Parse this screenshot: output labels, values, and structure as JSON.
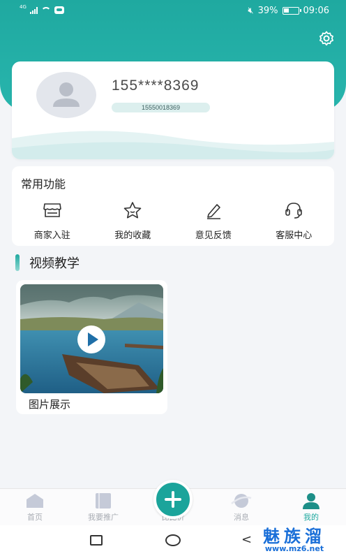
{
  "status_bar": {
    "network": "4G",
    "battery_percent": "39%",
    "battery_level": 0.39,
    "time": "09:06"
  },
  "profile": {
    "masked_phone": "155****8369",
    "phone_number": "15550018369"
  },
  "functions": {
    "title": "常用功能",
    "items": [
      {
        "label": "商家入驻",
        "icon": "store-icon"
      },
      {
        "label": "我的收藏",
        "icon": "star-icon"
      },
      {
        "label": "意见反馈",
        "icon": "pencil-icon"
      },
      {
        "label": "客服中心",
        "icon": "headset-icon"
      }
    ]
  },
  "video_section": {
    "title": "视频教学",
    "videos": [
      {
        "title": "图片展示",
        "icon": "play-icon"
      }
    ]
  },
  "tab_bar": {
    "tabs": [
      {
        "label": "首页",
        "icon": "home-icon"
      },
      {
        "label": "我要推广",
        "icon": "book-icon"
      },
      {
        "label": "比比价",
        "icon": "plus-icon"
      },
      {
        "label": "消息",
        "icon": "planet-icon"
      },
      {
        "label": "我的",
        "icon": "user-icon"
      }
    ],
    "active": "我的"
  },
  "watermark": {
    "text": "魅族溜",
    "url": "www.mz6.net"
  },
  "colors": {
    "accent": "#1fa9a0",
    "watermark": "#1a6fd8"
  }
}
